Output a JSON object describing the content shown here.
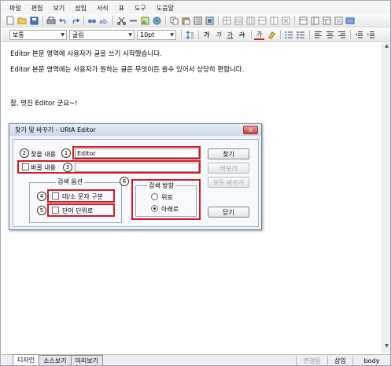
{
  "menubar": [
    "파일",
    "편집",
    "보기",
    "삽입",
    "서식",
    "표",
    "도구",
    "도움말"
  ],
  "toolbar2": {
    "style_value": "보통",
    "font_value": "굴림",
    "size_value": "10pt",
    "bold_label": "가",
    "italic_label": "가",
    "underline_label": "가",
    "strike_label": "가",
    "color_label": "가"
  },
  "editor": {
    "lines": [
      "Editor 본문 영역에 사용자가 글을 쓰기 시작했습니다.",
      "Editor 본문 영역에는 사용자가 원하는 글은 무엇이든 쓸수 있어서 상당히 편합니다.",
      "참, 멋진 Editor 군요~!"
    ]
  },
  "dialog": {
    "title": "찾기 및 바꾸기 - URIA Editor",
    "close_label": "X",
    "find_label": "찾을 내용",
    "find_value": "Editor",
    "replace_label": "바꿀 내용",
    "replace_value": "",
    "options_title": "검색 옵션",
    "case_label": "대/소 문자 구분",
    "word_label": "단어 단위로",
    "direction_title": "검색 방향",
    "up_label": "위로",
    "down_label": "아래로",
    "find_button": "찾기",
    "replace_button": "바꾸기",
    "replace_all_button": "모두 바꾸기",
    "close_button": "닫기",
    "direction_selected": "아래로",
    "markers": [
      "1",
      "2",
      "3",
      "4",
      "5",
      "6"
    ],
    "highlight_color": "#d51a24"
  },
  "statusbar": {
    "tabs": [
      "디자인",
      "소스보기",
      "미리보기"
    ],
    "active_tab": "디자인",
    "mode": "변경됨",
    "insert": "삽입",
    "element": "body"
  }
}
